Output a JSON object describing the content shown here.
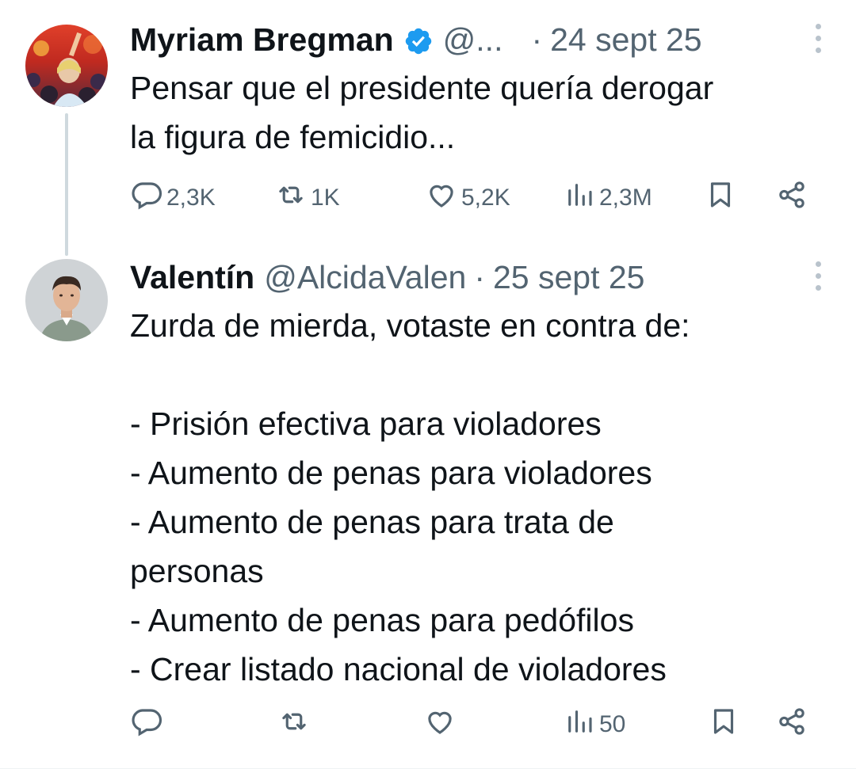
{
  "colors": {
    "text": "#0f1419",
    "secondary": "#536471",
    "verified": "#1d9bf0",
    "thread_line": "#cfd9de"
  },
  "tweets": [
    {
      "name": "Myriam Bregman",
      "verified": true,
      "handle": "@...",
      "separator": "·",
      "date": "24 sept 25",
      "body": [
        "Pensar que el presidente quería derogar",
        "la figura de femicidio..."
      ],
      "stats": {
        "replies": "2,3K",
        "retweets": "1K",
        "likes": "5,2K",
        "views": "2,3M"
      }
    },
    {
      "name": "Valentín",
      "verified": false,
      "handle": "@AlcidaValen",
      "separator": "·",
      "date": "25 sept 25",
      "body": [
        "Zurda de mierda, votaste en contra de:",
        "",
        "- Prisión efectiva para violadores",
        "- Aumento de penas para violadores",
        "- Aumento de penas para trata de",
        "personas",
        "- Aumento de penas para pedófilos",
        "- Crear listado nacional de violadores"
      ],
      "stats": {
        "replies": "",
        "retweets": "",
        "likes": "",
        "views": "50"
      }
    }
  ],
  "icons": [
    "verified-badge-icon",
    "more-options-icon",
    "reply-icon",
    "retweet-icon",
    "like-icon",
    "views-icon",
    "bookmark-icon",
    "share-icon"
  ]
}
